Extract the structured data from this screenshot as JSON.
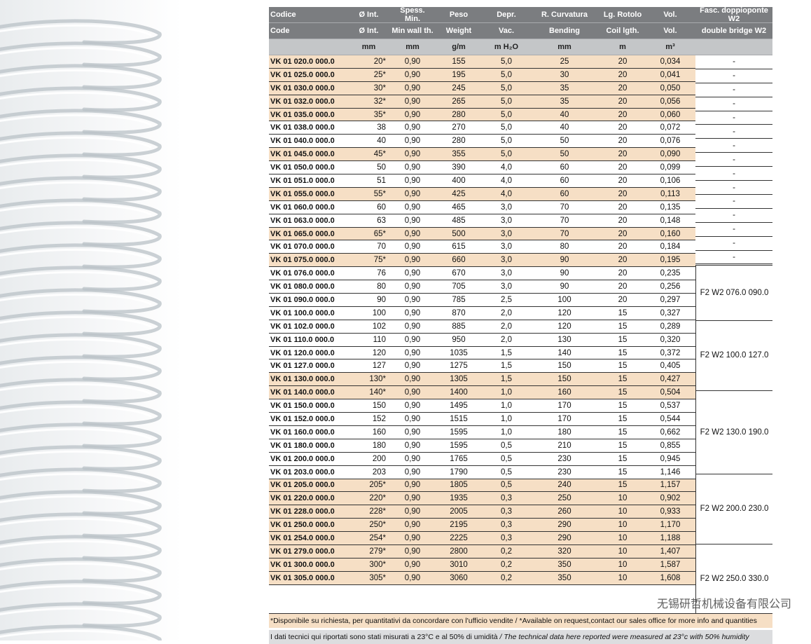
{
  "header": {
    "row1": [
      "Codice",
      "Ø Int.",
      "Spess. Min.",
      "Peso",
      "Depr.",
      "R. Curvatura",
      "Lg. Rotolo",
      "Vol.",
      "Fasc. doppioponte W2"
    ],
    "row2": [
      "Code",
      "Ø Int.",
      "Min wall th.",
      "Weight",
      "Vac.",
      "Bending",
      "Coil lgth.",
      "Vol.",
      "double bridge W2"
    ],
    "units": [
      "",
      "mm",
      "mm",
      "g/m",
      "m H₂O",
      "mm",
      "m",
      "m³",
      ""
    ]
  },
  "rows": [
    {
      "code": "VK 01 020.0 000.0",
      "d": "20*",
      "t": "0,90",
      "w": "155",
      "v": "5,0",
      "b": "25",
      "l": "20",
      "vol": "0,034",
      "hl": true
    },
    {
      "code": "VK 01 025.0 000.0",
      "d": "25*",
      "t": "0,90",
      "w": "195",
      "v": "5,0",
      "b": "30",
      "l": "20",
      "vol": "0,041",
      "hl": true
    },
    {
      "code": "VK 01 030.0 000.0",
      "d": "30*",
      "t": "0,90",
      "w": "245",
      "v": "5,0",
      "b": "35",
      "l": "20",
      "vol": "0,050",
      "hl": true
    },
    {
      "code": "VK 01 032.0 000.0",
      "d": "32*",
      "t": "0,90",
      "w": "265",
      "v": "5,0",
      "b": "35",
      "l": "20",
      "vol": "0,056",
      "hl": true
    },
    {
      "code": "VK 01 035.0 000.0",
      "d": "35*",
      "t": "0,90",
      "w": "280",
      "v": "5,0",
      "b": "40",
      "l": "20",
      "vol": "0,060",
      "hl": true
    },
    {
      "code": "VK 01 038.0 000.0",
      "d": "38",
      "t": "0,90",
      "w": "270",
      "v": "5,0",
      "b": "40",
      "l": "20",
      "vol": "0,072",
      "hl": false
    },
    {
      "code": "VK 01 040.0 000.0",
      "d": "40",
      "t": "0,90",
      "w": "280",
      "v": "5,0",
      "b": "50",
      "l": "20",
      "vol": "0,076",
      "hl": false
    },
    {
      "code": "VK 01 045.0 000.0",
      "d": "45*",
      "t": "0,90",
      "w": "355",
      "v": "5,0",
      "b": "50",
      "l": "20",
      "vol": "0,090",
      "hl": true
    },
    {
      "code": "VK 01 050.0 000.0",
      "d": "50",
      "t": "0,90",
      "w": "390",
      "v": "4,0",
      "b": "60",
      "l": "20",
      "vol": "0,099",
      "hl": false
    },
    {
      "code": "VK 01 051.0 000.0",
      "d": "51",
      "t": "0,90",
      "w": "400",
      "v": "4,0",
      "b": "60",
      "l": "20",
      "vol": "0,106",
      "hl": false
    },
    {
      "code": "VK 01 055.0 000.0",
      "d": "55*",
      "t": "0,90",
      "w": "425",
      "v": "4,0",
      "b": "60",
      "l": "20",
      "vol": "0,113",
      "hl": true
    },
    {
      "code": "VK 01 060.0 000.0",
      "d": "60",
      "t": "0,90",
      "w": "465",
      "v": "3,0",
      "b": "70",
      "l": "20",
      "vol": "0,135",
      "hl": false
    },
    {
      "code": "VK 01 063.0 000.0",
      "d": "63",
      "t": "0,90",
      "w": "485",
      "v": "3,0",
      "b": "70",
      "l": "20",
      "vol": "0,148",
      "hl": false
    },
    {
      "code": "VK 01 065.0 000.0",
      "d": "65*",
      "t": "0,90",
      "w": "500",
      "v": "3,0",
      "b": "70",
      "l": "20",
      "vol": "0,160",
      "hl": true
    },
    {
      "code": "VK 01 070.0 000.0",
      "d": "70",
      "t": "0,90",
      "w": "615",
      "v": "3,0",
      "b": "80",
      "l": "20",
      "vol": "0,184",
      "hl": false
    },
    {
      "code": "VK 01 075.0 000.0",
      "d": "75*",
      "t": "0,90",
      "w": "660",
      "v": "3,0",
      "b": "90",
      "l": "20",
      "vol": "0,195",
      "hl": true
    },
    {
      "code": "VK 01 076.0 000.0",
      "d": "76",
      "t": "0,90",
      "w": "670",
      "v": "3,0",
      "b": "90",
      "l": "20",
      "vol": "0,235",
      "hl": false
    },
    {
      "code": "VK 01 080.0 000.0",
      "d": "80",
      "t": "0,90",
      "w": "705",
      "v": "3,0",
      "b": "90",
      "l": "20",
      "vol": "0,256",
      "hl": false
    },
    {
      "code": "VK 01 090.0 000.0",
      "d": "90",
      "t": "0,90",
      "w": "785",
      "v": "2,5",
      "b": "100",
      "l": "20",
      "vol": "0,297",
      "hl": false
    },
    {
      "code": "VK 01 100.0 000.0",
      "d": "100",
      "t": "0,90",
      "w": "870",
      "v": "2,0",
      "b": "120",
      "l": "15",
      "vol": "0,327",
      "hl": false
    },
    {
      "code": "VK 01 102.0 000.0",
      "d": "102",
      "t": "0,90",
      "w": "885",
      "v": "2,0",
      "b": "120",
      "l": "15",
      "vol": "0,289",
      "hl": false
    },
    {
      "code": "VK 01 110.0 000.0",
      "d": "110",
      "t": "0,90",
      "w": "950",
      "v": "2,0",
      "b": "130",
      "l": "15",
      "vol": "0,320",
      "hl": false
    },
    {
      "code": "VK 01 120.0 000.0",
      "d": "120",
      "t": "0,90",
      "w": "1035",
      "v": "1,5",
      "b": "140",
      "l": "15",
      "vol": "0,372",
      "hl": false
    },
    {
      "code": "VK 01 127.0 000.0",
      "d": "127",
      "t": "0,90",
      "w": "1275",
      "v": "1,5",
      "b": "150",
      "l": "15",
      "vol": "0,405",
      "hl": false
    },
    {
      "code": "VK 01 130.0 000.0",
      "d": "130*",
      "t": "0,90",
      "w": "1305",
      "v": "1,5",
      "b": "150",
      "l": "15",
      "vol": "0,427",
      "hl": true
    },
    {
      "code": "VK 01 140.0 000.0",
      "d": "140*",
      "t": "0,90",
      "w": "1400",
      "v": "1,0",
      "b": "160",
      "l": "15",
      "vol": "0,504",
      "hl": true
    },
    {
      "code": "VK 01 150.0 000.0",
      "d": "150",
      "t": "0,90",
      "w": "1495",
      "v": "1,0",
      "b": "170",
      "l": "15",
      "vol": "0,537",
      "hl": false
    },
    {
      "code": "VK 01 152.0 000.0",
      "d": "152",
      "t": "0,90",
      "w": "1515",
      "v": "1,0",
      "b": "170",
      "l": "15",
      "vol": "0,544",
      "hl": false
    },
    {
      "code": "VK 01 160.0 000.0",
      "d": "160",
      "t": "0,90",
      "w": "1595",
      "v": "1,0",
      "b": "180",
      "l": "15",
      "vol": "0,662",
      "hl": false
    },
    {
      "code": "VK 01 180.0 000.0",
      "d": "180",
      "t": "0,90",
      "w": "1595",
      "v": "0,5",
      "b": "210",
      "l": "15",
      "vol": "0,855",
      "hl": false
    },
    {
      "code": "VK 01 200.0 000.0",
      "d": "200",
      "t": "0,90",
      "w": "1765",
      "v": "0,5",
      "b": "230",
      "l": "15",
      "vol": "0,945",
      "hl": false
    },
    {
      "code": "VK 01 203.0 000.0",
      "d": "203",
      "t": "0,90",
      "w": "1790",
      "v": "0,5",
      "b": "230",
      "l": "15",
      "vol": "1,146",
      "hl": false
    },
    {
      "code": "VK 01 205.0 000.0",
      "d": "205*",
      "t": "0,90",
      "w": "1805",
      "v": "0,5",
      "b": "240",
      "l": "15",
      "vol": "1,157",
      "hl": true
    },
    {
      "code": "VK 01 220.0 000.0",
      "d": "220*",
      "t": "0,90",
      "w": "1935",
      "v": "0,3",
      "b": "250",
      "l": "10",
      "vol": "0,902",
      "hl": true
    },
    {
      "code": "VK 01 228.0 000.0",
      "d": "228*",
      "t": "0,90",
      "w": "2005",
      "v": "0,3",
      "b": "260",
      "l": "10",
      "vol": "0,933",
      "hl": true
    },
    {
      "code": "VK 01 250.0 000.0",
      "d": "250*",
      "t": "0,90",
      "w": "2195",
      "v": "0,3",
      "b": "290",
      "l": "10",
      "vol": "1,170",
      "hl": true
    },
    {
      "code": "VK 01 254.0 000.0",
      "d": "254*",
      "t": "0,90",
      "w": "2225",
      "v": "0,3",
      "b": "290",
      "l": "10",
      "vol": "1,188",
      "hl": true
    },
    {
      "code": "VK 01 279.0 000.0",
      "d": "279*",
      "t": "0,90",
      "w": "2800",
      "v": "0,2",
      "b": "320",
      "l": "10",
      "vol": "1,407",
      "hl": true
    },
    {
      "code": "VK 01 300.0 000.0",
      "d": "300*",
      "t": "0,90",
      "w": "3010",
      "v": "0,2",
      "b": "350",
      "l": "10",
      "vol": "1,587",
      "hl": true
    },
    {
      "code": "VK 01 305.0 000.0",
      "d": "305*",
      "t": "0,90",
      "w": "3060",
      "v": "0,2",
      "b": "350",
      "l": "10",
      "vol": "1,608",
      "hl": true
    }
  ],
  "w2_dash": "-",
  "w2_groups": [
    {
      "label": "F2 W2 076.0 090.0",
      "rows": 4
    },
    {
      "label": "F2 W2 100.0 127.0",
      "rows": 5
    },
    {
      "label": "F2 W2 130.0 190.0",
      "rows": 6
    },
    {
      "label": "F2 W2 200.0 230.0",
      "rows": 5
    },
    {
      "label": "F2 W2 250.0 330.0",
      "rows": 5
    }
  ],
  "notes": {
    "availability": "*Disponibile su richiesta, per quantitativi da concordare con l'ufficio vendite / *Available on request,contact our sales office for more info and quantities",
    "conditions_it": "I dati tecnici qui riportati sono stati misurati a 23°C e al 50% di umidità",
    "conditions_en": "/ The technical data here reported were measured at 23°c with 50% humidity"
  },
  "watermark": "无锡研哲机械设备有限公司",
  "colors": {
    "header_dark": "#7b7d80",
    "header_light": "#c4c6c8",
    "highlight": "#f6dfc5",
    "note_grey": "#dcdddf"
  }
}
